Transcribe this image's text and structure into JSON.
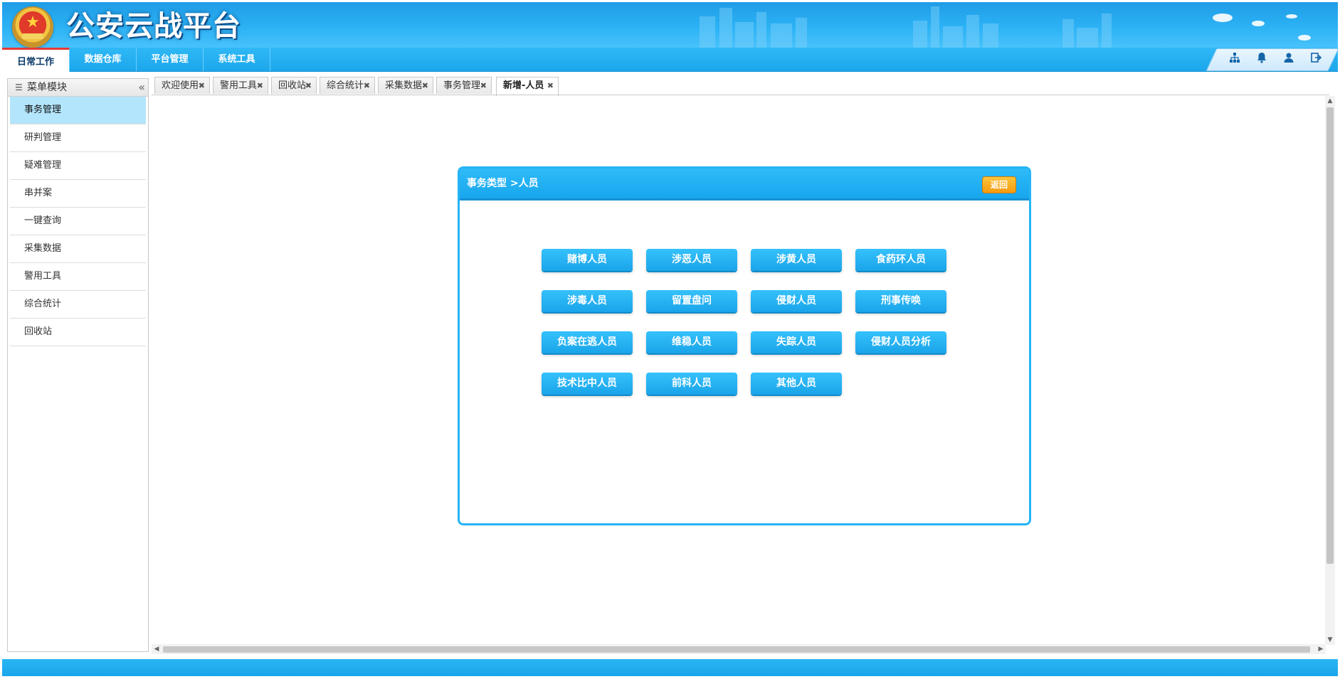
{
  "header": {
    "title": "公安云战平台",
    "emblem_icon": "police-emblem-icon"
  },
  "topnav": {
    "tabs": [
      {
        "label": "日常工作",
        "active": true
      },
      {
        "label": "数据仓库",
        "active": false
      },
      {
        "label": "平台管理",
        "active": false
      },
      {
        "label": "系统工具",
        "active": false
      }
    ],
    "tools": [
      "org-chart-icon",
      "bell-icon",
      "user-icon",
      "logout-icon"
    ]
  },
  "sidebar": {
    "header": "菜单模块",
    "items": [
      {
        "label": "事务管理",
        "active": true
      },
      {
        "label": "研判管理"
      },
      {
        "label": "疑难管理"
      },
      {
        "label": "串并案"
      },
      {
        "label": "一键查询"
      },
      {
        "label": "采集数据"
      },
      {
        "label": "警用工具"
      },
      {
        "label": "综合统计"
      },
      {
        "label": "回收站"
      }
    ]
  },
  "tabs": [
    {
      "label": "欢迎使用"
    },
    {
      "label": "警用工具"
    },
    {
      "label": "回收站"
    },
    {
      "label": "综合统计"
    },
    {
      "label": "采集数据"
    },
    {
      "label": "事务管理"
    },
    {
      "label": "新增-人员",
      "active": true
    }
  ],
  "dialog": {
    "title": "事务类型 >人员",
    "back_label": "返回",
    "categories": [
      "赌博人员",
      "涉恶人员",
      "涉黄人员",
      "食药环人员",
      "涉毒人员",
      "留置盘问",
      "侵财人员",
      "刑事传唤",
      "负案在逃人员",
      "维稳人员",
      "失踪人员",
      "侵财人员分析",
      "技术比中人员",
      "前科人员",
      "其他人员"
    ]
  },
  "colors": {
    "accent": "#1ea9ee",
    "active_tab_marker": "#e53935",
    "back_button": "#f5a31a",
    "menu_active": "#b3e5fc"
  }
}
